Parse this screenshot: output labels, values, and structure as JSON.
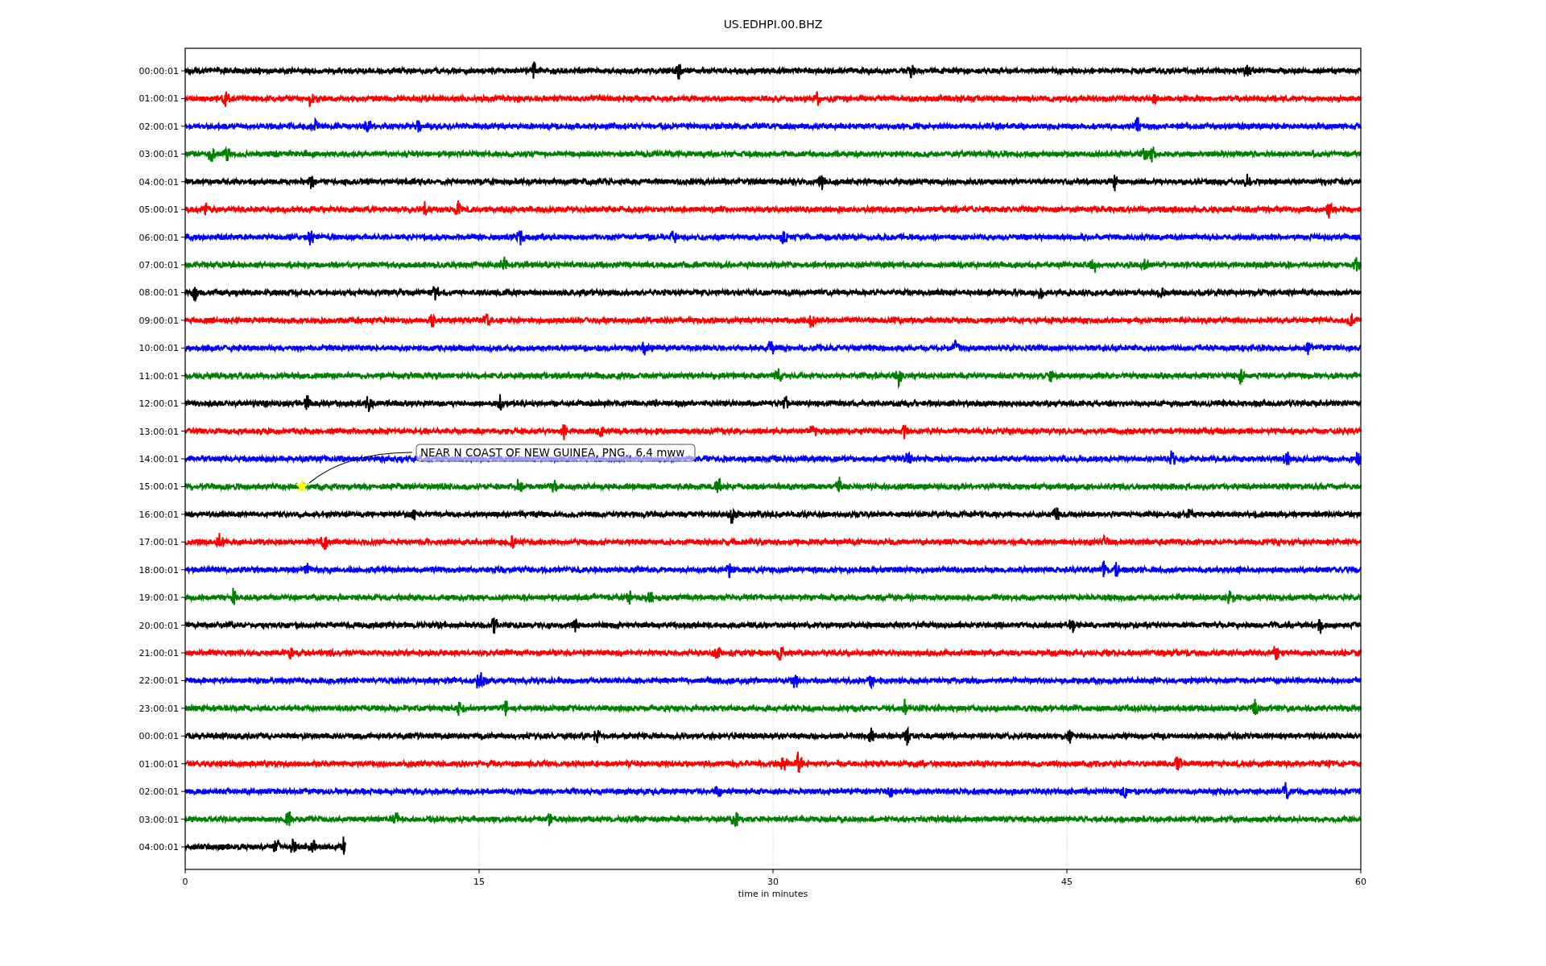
{
  "title": "US.EDHPI.00.BHZ",
  "rows": [
    {
      "label": "00:00:01",
      "color": "#000000",
      "partial": false
    },
    {
      "label": "01:00:01",
      "color": "#ff0000",
      "partial": false
    },
    {
      "label": "02:00:01",
      "color": "#0000ff",
      "partial": false
    },
    {
      "label": "03:00:01",
      "color": "#008000",
      "partial": false
    },
    {
      "label": "04:00:01",
      "color": "#000000",
      "partial": false
    },
    {
      "label": "05:00:01",
      "color": "#ff0000",
      "partial": false
    },
    {
      "label": "06:00:01",
      "color": "#0000ff",
      "partial": false
    },
    {
      "label": "07:00:01",
      "color": "#008000",
      "partial": false
    },
    {
      "label": "08:00:01",
      "color": "#000000",
      "partial": false
    },
    {
      "label": "09:00:01",
      "color": "#ff0000",
      "partial": false
    },
    {
      "label": "10:00:01",
      "color": "#0000ff",
      "partial": false
    },
    {
      "label": "11:00:01",
      "color": "#008000",
      "partial": false
    },
    {
      "label": "12:00:01",
      "color": "#000000",
      "partial": false
    },
    {
      "label": "13:00:01",
      "color": "#ff0000",
      "partial": false
    },
    {
      "label": "14:00:01",
      "color": "#0000ff",
      "partial": false
    },
    {
      "label": "15:00:01",
      "color": "#008000",
      "partial": false
    },
    {
      "label": "16:00:01",
      "color": "#000000",
      "partial": false
    },
    {
      "label": "17:00:01",
      "color": "#ff0000",
      "partial": false
    },
    {
      "label": "18:00:01",
      "color": "#0000ff",
      "partial": false
    },
    {
      "label": "19:00:01",
      "color": "#008000",
      "partial": false
    },
    {
      "label": "20:00:01",
      "color": "#000000",
      "partial": false
    },
    {
      "label": "21:00:01",
      "color": "#ff0000",
      "partial": false
    },
    {
      "label": "22:00:01",
      "color": "#0000ff",
      "partial": false
    },
    {
      "label": "23:00:01",
      "color": "#008000",
      "partial": false
    },
    {
      "label": "00:00:01",
      "color": "#000000",
      "partial": false
    },
    {
      "label": "01:00:01",
      "color": "#ff0000",
      "partial": false
    },
    {
      "label": "02:00:01",
      "color": "#0000ff",
      "partial": false
    },
    {
      "label": "03:00:01",
      "color": "#008000",
      "partial": false
    },
    {
      "label": "04:00:01",
      "color": "#000000",
      "partial": true
    }
  ],
  "xticks": [
    "0",
    "15",
    "30",
    "45",
    "60"
  ],
  "xlabel": "time in minutes",
  "annotation": {
    "text": "NEAR N COAST OF NEW GUINEA, PNG., 6.4 mww"
  }
}
